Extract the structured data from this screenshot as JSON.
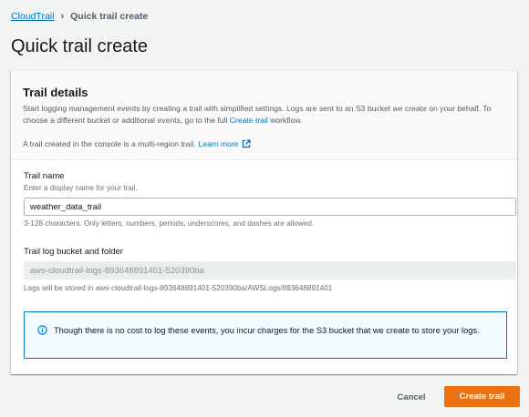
{
  "breadcrumb": {
    "parent": "CloudTrail",
    "current": "Quick trail create"
  },
  "page_title": "Quick trail create",
  "panel": {
    "title": "Trail details",
    "description_1": "Start logging management events by creating a trail with simplified settings. Logs are sent to an S3 bucket we create on your behalf. To choose a different bucket or additional events, go to the full ",
    "description_link": "Create trail",
    "description_2": " workflow.",
    "note": "A trail created in the console is a multi-region trail.",
    "note_link": "Learn more"
  },
  "trail_name": {
    "label": "Trail name",
    "help": "Enter a display name for your trail.",
    "value": "weather_data_trail",
    "constraint": "3-128 characters. Only letters, numbers, periods, underscores, and dashes are allowed."
  },
  "bucket": {
    "label": "Trail log bucket and folder",
    "value": "aws-cloudtrail-logs-893648891401-520390ba",
    "help": "Logs will be stored in aws-cloudtrail-logs-893648891401-520390ba/AWSLogs/893648891401"
  },
  "info": {
    "text": "Though there is no cost to log these events, you incur charges for the S3 bucket that we create to store your logs."
  },
  "footer": {
    "cancel_label": "Cancel",
    "create_label": "Create trail"
  },
  "colors": {
    "link": "#0073bb",
    "primary": "#ec7211",
    "info_bg": "#f1faff",
    "page_bg": "#f2f3f3"
  },
  "icons": {
    "breadcrumb_separator": "chevron-right-icon",
    "external_link": "external-link-icon",
    "info": "info-icon"
  }
}
